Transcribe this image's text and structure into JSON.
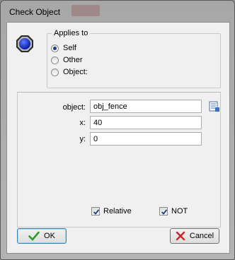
{
  "window": {
    "title": "Check Object"
  },
  "applies_to": {
    "label": "Applies to",
    "options": [
      {
        "label": "Self",
        "selected": true
      },
      {
        "label": "Other",
        "selected": false
      },
      {
        "label": "Object:",
        "selected": false
      }
    ]
  },
  "fields": {
    "object": {
      "label": "object:",
      "value": "obj_fence"
    },
    "x": {
      "label": "x:",
      "value": "40"
    },
    "y": {
      "label": "y:",
      "value": "0"
    }
  },
  "checks": {
    "relative": {
      "label": "Relative",
      "checked": true
    },
    "not": {
      "label": "NOT",
      "checked": true
    }
  },
  "buttons": {
    "ok": "OK",
    "cancel": "Cancel"
  },
  "icons": {
    "action": "blue-octagon-icon",
    "object_picker": "object-menu-icon",
    "ok": "green-check-icon",
    "cancel": "red-x-icon"
  },
  "colors": {
    "accent": "#1c3e86",
    "ok_check": "#2e9a2e",
    "cancel_x": "#c62828"
  }
}
